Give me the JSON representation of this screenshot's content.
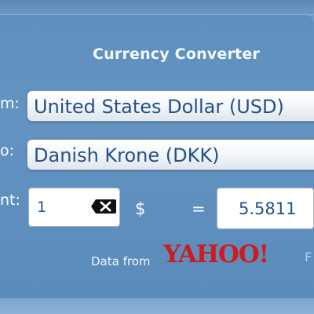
{
  "app": {
    "title": "Currency Converter"
  },
  "form": {
    "from_label": "m:",
    "to_label": "o:",
    "amount_label": "nt:",
    "from_value": "United States Dollar (USD)",
    "to_value": "Danish Krone (DKK)",
    "amount_value": "1",
    "currency_symbol": "$",
    "equals": "=",
    "result_value": "5.5811",
    "clear_icon": "clear-input-icon"
  },
  "attribution": {
    "text": "Data from",
    "provider": "YAHOO!",
    "trailing_fragment": "F"
  },
  "colors": {
    "accent_text": "#23508a",
    "panel_blue": "#6393c1",
    "brand_red": "#d01b1b"
  }
}
